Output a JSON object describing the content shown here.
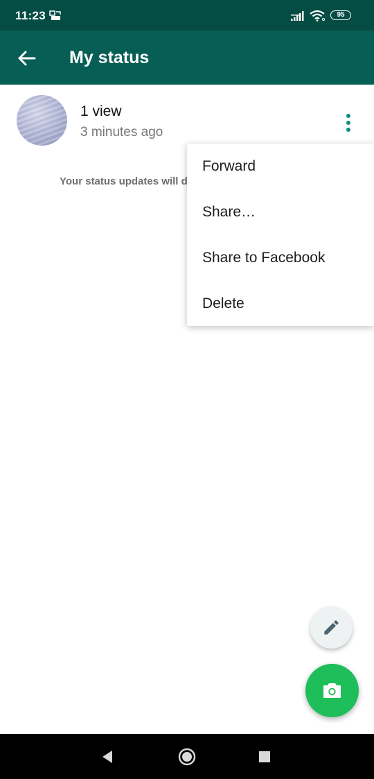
{
  "status_bar": {
    "time": "11:23",
    "battery": "95",
    "icons": [
      "notification-icon",
      "signal-icon",
      "wifi-icon",
      "battery-icon"
    ]
  },
  "app_bar": {
    "title": "My status",
    "back_icon": "arrow-left-icon",
    "color": "#075e54"
  },
  "status_item": {
    "views": "1 view",
    "time_ago": "3 minutes ago",
    "more_icon": "more-vertical-icon"
  },
  "info_text": "Your status updates will d",
  "menu": {
    "items": [
      {
        "label": "Forward"
      },
      {
        "label": "Share…"
      },
      {
        "label": "Share to Facebook"
      },
      {
        "label": "Delete"
      }
    ]
  },
  "fabs": {
    "pencil_icon": "pencil-icon",
    "camera_icon": "camera-icon",
    "camera_color": "#1ebe5a"
  },
  "nav_bar": {
    "icons": [
      "back-triangle-icon",
      "home-circle-icon",
      "recents-square-icon"
    ]
  }
}
